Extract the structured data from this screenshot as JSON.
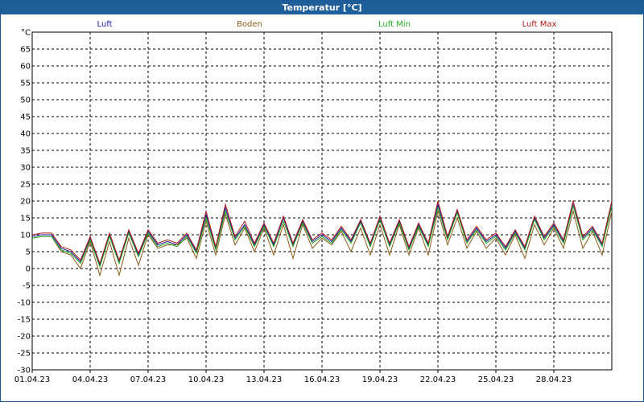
{
  "window": {
    "title": "Temperatur [°C]"
  },
  "colors": {
    "Luft": "#1a1aa6",
    "Boden": "#8b5a1a",
    "Luft Min": "#22aa22",
    "Luft Max": "#b01818",
    "grid": "#000000",
    "titlebar": "#1f5f99"
  },
  "chart_data": {
    "type": "line",
    "title": "Temperatur [°C]",
    "ylabel": "°C",
    "xlabel": "",
    "ylim": [
      -30,
      70
    ],
    "yticks": [
      -30,
      -25,
      -20,
      -15,
      -10,
      -5,
      0,
      5,
      10,
      15,
      20,
      25,
      30,
      35,
      40,
      45,
      50,
      55,
      60,
      65
    ],
    "xlim": [
      "2023-04-01",
      "2023-05-01"
    ],
    "xticks": [
      "01.04.23",
      "04.04.23",
      "07.04.23",
      "10.04.23",
      "13.04.23",
      "16.04.23",
      "19.04.23",
      "22.04.23",
      "25.04.23",
      "28.04.23"
    ],
    "grid": true,
    "legend_position": "top",
    "x_days": [
      0,
      0.5,
      1,
      1.5,
      2,
      2.5,
      3,
      3.5,
      4,
      4.5,
      5,
      5.5,
      6,
      6.5,
      7,
      7.5,
      8,
      8.5,
      9,
      9.5,
      10,
      10.5,
      11,
      11.5,
      12,
      12.5,
      13,
      13.5,
      14,
      14.5,
      15,
      15.5,
      16,
      16.5,
      17,
      17.5,
      18,
      18.5,
      19,
      19.5,
      20,
      20.5,
      21,
      21.5,
      22,
      22.5,
      23,
      23.5,
      24,
      24.5,
      25,
      25.5,
      26,
      26.5,
      27,
      27.5,
      28,
      28.5,
      29,
      29.5,
      30
    ],
    "series": [
      {
        "name": "Luft",
        "values": [
          9.5,
          10,
          10,
          6,
          5,
          2,
          9,
          1,
          10,
          2,
          11,
          4,
          11,
          7,
          8,
          7,
          10,
          5,
          16,
          6,
          18,
          9,
          13,
          7,
          13,
          7,
          15,
          7,
          14,
          8,
          10,
          8,
          12,
          8,
          14,
          7,
          15,
          7,
          14,
          6,
          13,
          7,
          19,
          9,
          17,
          8,
          12,
          8,
          10,
          6,
          11,
          6,
          15,
          9,
          13,
          8,
          19,
          9,
          12,
          7,
          19
        ]
      },
      {
        "name": "Boden",
        "values": [
          9,
          9.5,
          9.5,
          5,
          4,
          0,
          8,
          -2,
          8,
          -2,
          9,
          1,
          10,
          6,
          7,
          7,
          9,
          3,
          14,
          4,
          16,
          7,
          12,
          5,
          12,
          4,
          13,
          3,
          13,
          6,
          9,
          7,
          11,
          5,
          12,
          4,
          13,
          4,
          13,
          4,
          12,
          4,
          17,
          7,
          15,
          6,
          11,
          6,
          9,
          4,
          10,
          3,
          13,
          7,
          12,
          6,
          17,
          6,
          11,
          4,
          17
        ]
      },
      {
        "name": "Luft Min",
        "values": [
          9,
          9.5,
          9.5,
          5.5,
          4.5,
          1.5,
          8.5,
          0.5,
          9.5,
          1.5,
          10.5,
          3.5,
          10.5,
          6.5,
          7.5,
          6.5,
          9.5,
          4.5,
          15,
          5.5,
          17,
          8.5,
          12.5,
          6.5,
          12.5,
          6.5,
          14,
          6.5,
          13.5,
          7.5,
          9.5,
          7.5,
          11.5,
          7.5,
          13.5,
          6.5,
          14.5,
          6.5,
          13.5,
          5.5,
          12.5,
          6.5,
          18,
          8.5,
          16.5,
          7.5,
          11.5,
          7.5,
          9.5,
          5.5,
          10.5,
          5.5,
          14.5,
          8.5,
          12.5,
          7.5,
          18.5,
          8.5,
          11.5,
          6.5,
          18.5
        ]
      },
      {
        "name": "Luft Max",
        "values": [
          10,
          10.5,
          10.5,
          6.5,
          5.5,
          2.5,
          9.5,
          1.5,
          10.5,
          2.5,
          11.5,
          4.5,
          11.5,
          7.5,
          8.5,
          7.5,
          10.5,
          5.5,
          17,
          6.5,
          19,
          9.5,
          14,
          7.5,
          13.5,
          7.5,
          15.5,
          7.5,
          14.5,
          8.5,
          10.5,
          8.5,
          12.5,
          8.5,
          14.5,
          7.5,
          15.5,
          7.5,
          14.5,
          6.5,
          13.5,
          7.5,
          20,
          9.5,
          17.5,
          8.5,
          12.5,
          8.5,
          10.5,
          6.5,
          11.5,
          6.5,
          15.5,
          9.5,
          13.5,
          8.5,
          20,
          9.5,
          12.5,
          7.5,
          20
        ]
      }
    ]
  }
}
